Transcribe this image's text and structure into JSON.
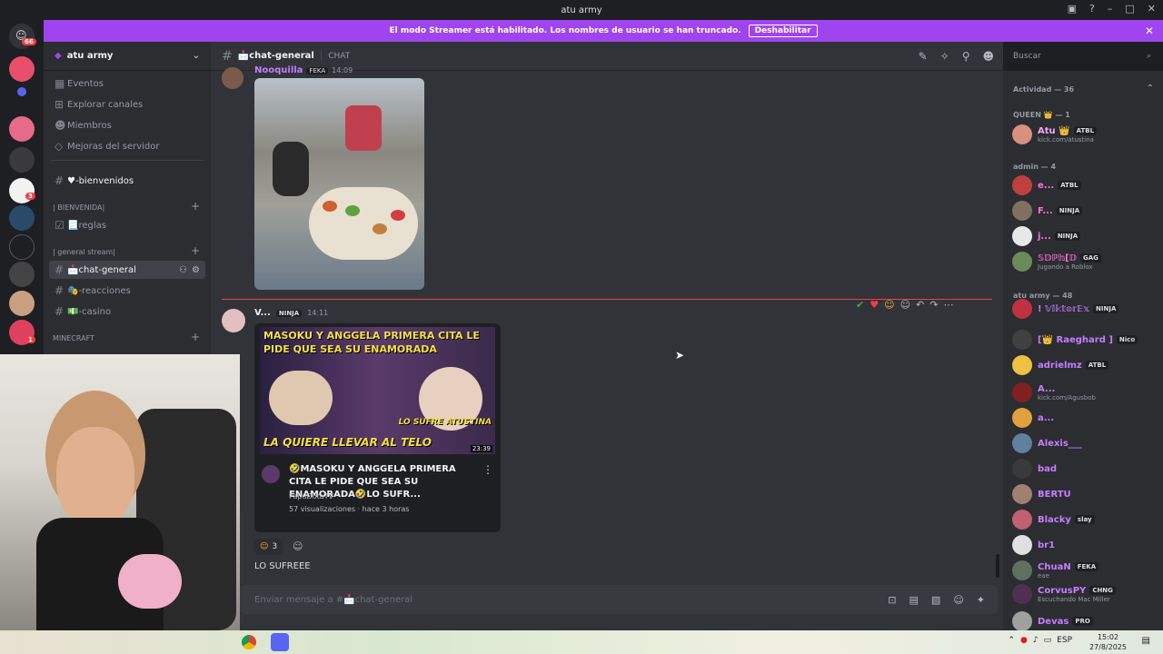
{
  "window": {
    "title": "atu army"
  },
  "banner": {
    "text": "El modo Streamer está habilitado. Los nombres de usuario se han truncado.",
    "button": "Deshabilitar"
  },
  "rail": {
    "badge_top": "66",
    "badge_a": "3",
    "badge_b": "1"
  },
  "guild": {
    "name": "atu army",
    "menu": [
      "Eventos",
      "Explorar canales",
      "Miembros",
      "Mejoras del servidor"
    ],
    "welcome_channel": "♥-bienvenidos",
    "categories": [
      {
        "label": "| BIENVENIDA|",
        "channels": [
          "📃reglas"
        ]
      },
      {
        "label": "| general stream|",
        "channels": [
          "📩chat-general",
          "🎭-reacciones",
          "💵-casino"
        ]
      },
      {
        "label": "MINECRAFT",
        "channels": []
      }
    ]
  },
  "header": {
    "channel": "📩chat-general",
    "kind": "CHAT",
    "search_placeholder": "Buscar"
  },
  "messages": [
    {
      "author": "Nooquilla",
      "badge": "FEKA",
      "time": "14:09"
    },
    {
      "author": "V...",
      "badge": "NINJA",
      "time": "14:11",
      "video": {
        "thumb_top": "MASOKU Y ANGGELA PRIMERA CITA LE PIDE QUE SEA SU ENAMORADA",
        "thumb_side": "LO SUFRE ATUSTINA",
        "thumb_bottom": "LA QUIERE LLEVAR AL TELO",
        "duration": "23:39",
        "title": "🤣MASOKU Y ANGGELA PRIMERA CITA LE PIDE QUE SEA SU ENAMORADA🤣LO SUFR...",
        "channel": "PapuDotaTV",
        "meta": "57 visualizaciones · hace 3 horas"
      },
      "reaction_count": "3",
      "text": "LO SUFREEE"
    }
  ],
  "composer": {
    "placeholder": "Enviar mensaje a #📩chat-general"
  },
  "members": {
    "activity": "Actividad — 36",
    "groups": [
      {
        "label": "QUEEN 👑 — 1"
      },
      {
        "label": "admin — 4"
      },
      {
        "label": "atu army — 48"
      }
    ],
    "list": [
      {
        "name": "Atu 👑",
        "tag": "ATBL",
        "sub": "kick.com/atustina",
        "color": "#f2a6ff"
      },
      {
        "name": "e...",
        "tag": "ATBL",
        "sub": "",
        "color": "#ff6fd8"
      },
      {
        "name": "F...",
        "tag": "NINJA",
        "sub": "",
        "color": "#ff6fd8"
      },
      {
        "name": "j...",
        "tag": "NINJA",
        "sub": "",
        "color": "#ff6fd8"
      },
      {
        "name": "𝕊𝔻ℙ𝕙[𝔻",
        "tag": "GAG",
        "sub": "Jugando a Roblox",
        "color": "#ff6fd8"
      },
      {
        "name": "! 𝕍𝕚𝕜𝕥𝕠𝕣𝔼𝕩",
        "tag": "NINJA",
        "sub": "",
        "color": "#c77dff"
      },
      {
        "name": "[👑 Raeghard ]",
        "tag": "Nico",
        "sub": "",
        "color": "#c77dff"
      },
      {
        "name": "adrielmz",
        "tag": "ATBL",
        "sub": "",
        "color": "#c77dff"
      },
      {
        "name": "A...",
        "tag": "",
        "sub": "kick.com/Agusbob",
        "color": "#c77dff"
      },
      {
        "name": "a...",
        "tag": "",
        "sub": "",
        "color": "#c77dff"
      },
      {
        "name": "Alexis___",
        "tag": "",
        "sub": "",
        "color": "#c77dff"
      },
      {
        "name": "bad",
        "tag": "",
        "sub": "",
        "color": "#c77dff"
      },
      {
        "name": "BERTU",
        "tag": "",
        "sub": "",
        "color": "#c77dff"
      },
      {
        "name": "Blacky",
        "tag": "slay",
        "sub": "",
        "color": "#c77dff"
      },
      {
        "name": "br1",
        "tag": "",
        "sub": "",
        "color": "#c77dff"
      },
      {
        "name": "ChuaN",
        "tag": "FEKA",
        "sub": "eae",
        "color": "#c77dff"
      },
      {
        "name": "CorvusPY",
        "tag": "CHNG",
        "sub": "Escuchando Mac Miller",
        "color": "#c77dff"
      },
      {
        "name": "Devas",
        "tag": "PRO",
        "sub": "",
        "color": "#c77dff"
      }
    ]
  },
  "taskbar": {
    "lang": "ESP",
    "time": "15:02",
    "date": "27/8/2025"
  }
}
